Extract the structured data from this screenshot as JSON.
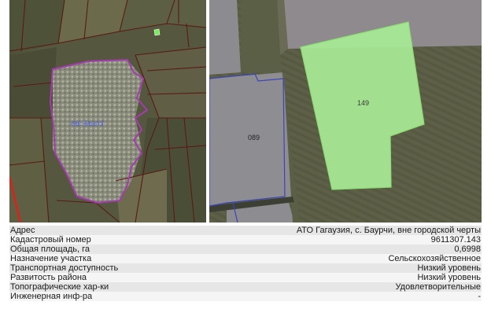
{
  "overview_map": {
    "village_label": "sat Baurci",
    "colors": {
      "boundary_village": "#a43bb0",
      "parcel_lines": "#5a1a14",
      "selected_parcel": "#78f05a",
      "side_line": "#e0201a"
    }
  },
  "detail_map": {
    "selected_parcel_label": "149",
    "neighbor_parcel_label": "089",
    "colors": {
      "selected_fill": "#a8ec96",
      "selected_stroke": "#8bdc73",
      "neighbor_stroke": "#3a44b8"
    }
  },
  "details": [
    {
      "label": "Адрес",
      "value": "АТО Гагаузия, с. Баурчи, вне городской черты"
    },
    {
      "label": "Кадастровый номер",
      "value": "9611307.143"
    },
    {
      "label": "Общая площадь, га",
      "value": "0,6998"
    },
    {
      "label": "Назначение участка",
      "value": "Сельскохозяйственное"
    },
    {
      "label": "Транспортная доступность",
      "value": "Низкий уровень"
    },
    {
      "label": "Развитость района",
      "value": "Низкий уровень"
    },
    {
      "label": "Топографические хар-ки",
      "value": "Удовлетворительные"
    },
    {
      "label": "Инженерная инф-ра",
      "value": "-"
    }
  ]
}
